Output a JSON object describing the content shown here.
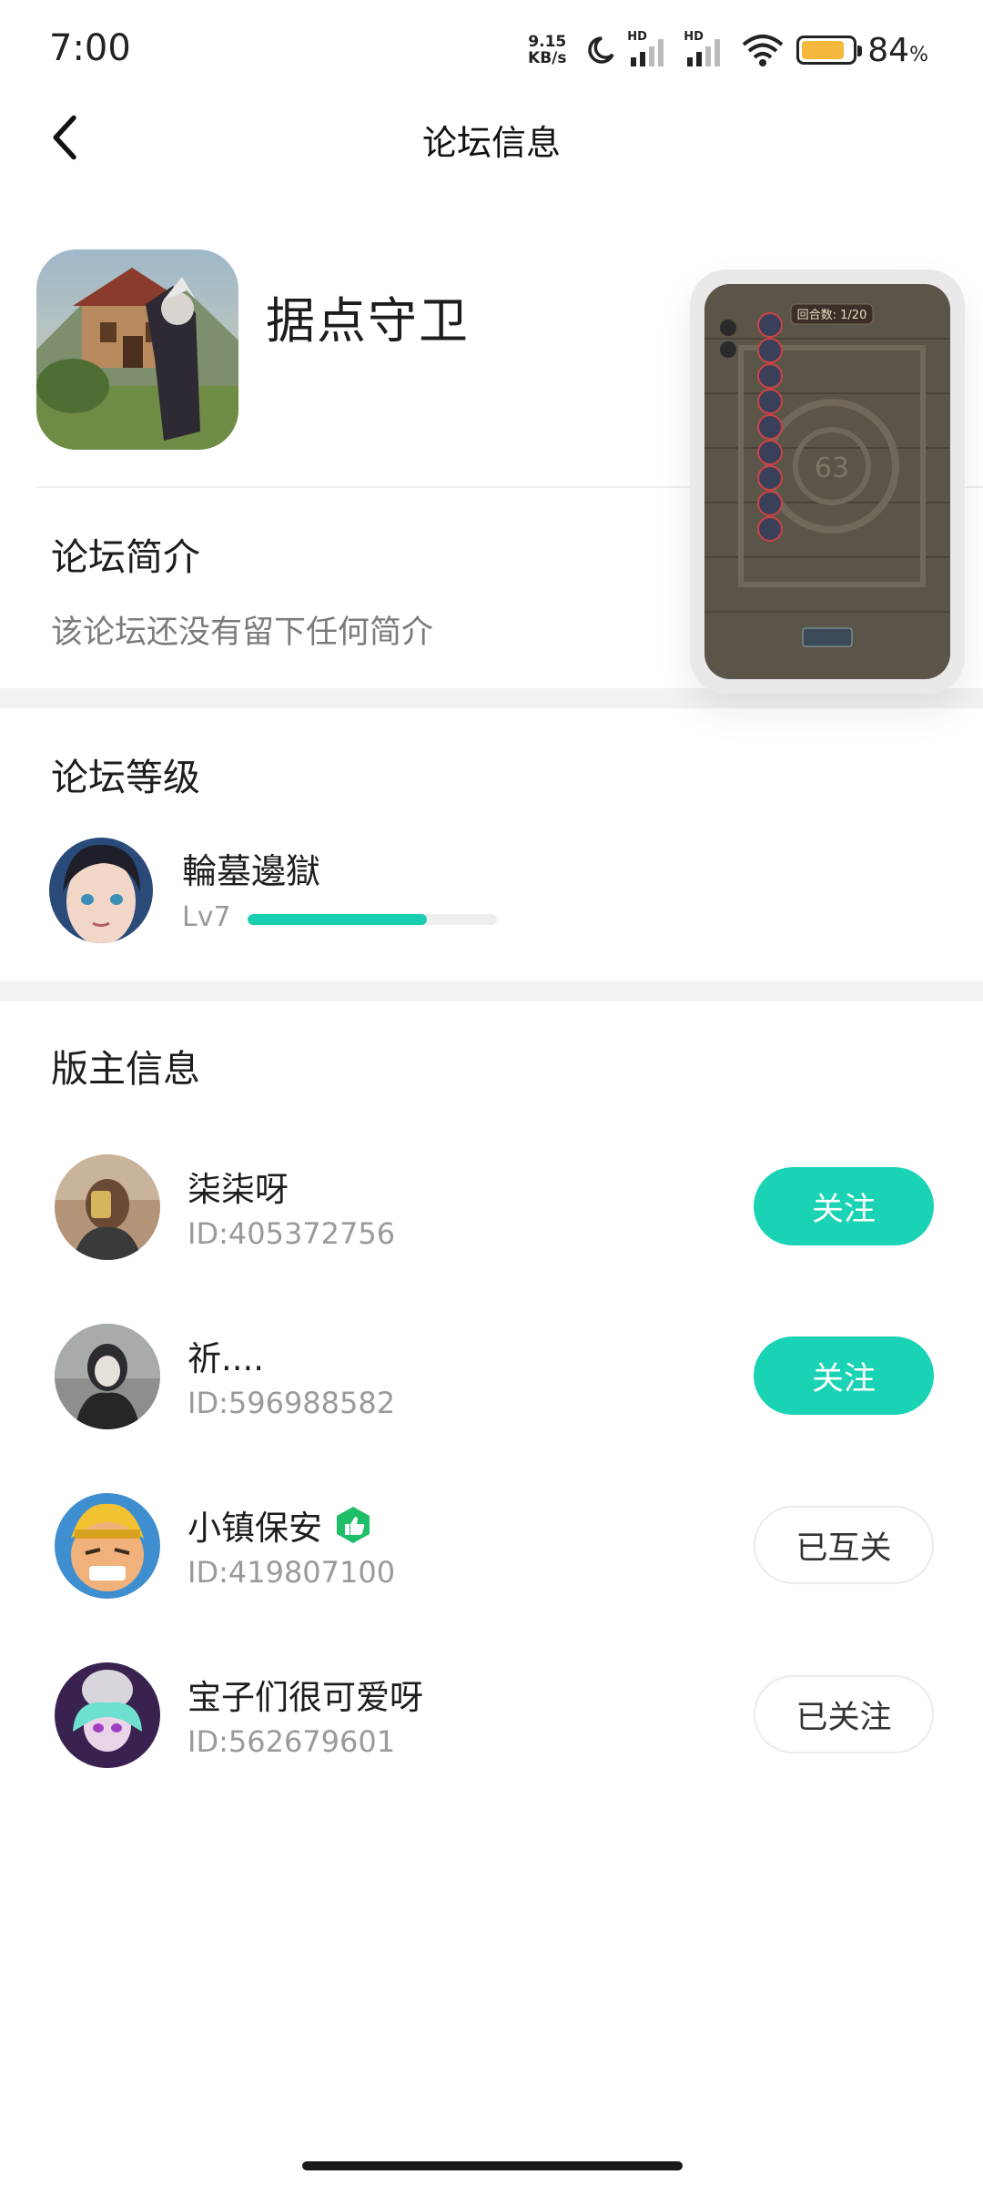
{
  "status_bar": {
    "time": "7:00",
    "net_speed_value": "9.15",
    "net_speed_unit": "KB/s",
    "signal_1_label": "HD",
    "signal_2_label": "HD",
    "battery_percent": "84",
    "battery_unit": "%",
    "battery_level": 0.84,
    "battery_color": "#f5b83c",
    "icons": [
      "moon-icon",
      "signal-icon",
      "signal-icon",
      "wifi-icon",
      "battery-icon"
    ]
  },
  "header": {
    "title": "论坛信息",
    "back_icon": "chevron-left-icon"
  },
  "forum": {
    "name": "据点守卫",
    "preview_round_label": "回合数: 1/20",
    "preview_center_number": "63"
  },
  "intro": {
    "title": "论坛简介",
    "text": "该论坛还没有留下任何简介"
  },
  "level": {
    "title": "论坛等级",
    "user_name": "輪墓邊獄",
    "level_label": "Lv7",
    "progress": 0.72,
    "progress_color": "#19cdb0"
  },
  "moderators": {
    "title": "版主信息",
    "items": [
      {
        "name": "柒柒呀",
        "id": "ID:405372756",
        "button": "关注",
        "button_style": "primary",
        "badge": false
      },
      {
        "name": "祈....",
        "id": "ID:596988582",
        "button": "关注",
        "button_style": "primary",
        "badge": false
      },
      {
        "name": "小镇保安",
        "id": "ID:419807100",
        "button": "已互关",
        "button_style": "secondary",
        "badge": true,
        "badge_icon": "thumbs-up-badge-icon"
      },
      {
        "name": "宝子们很可爱呀",
        "id": "ID:562679601",
        "button": "已关注",
        "button_style": "secondary",
        "badge": false
      }
    ]
  },
  "accent_color": "#19d3b4"
}
